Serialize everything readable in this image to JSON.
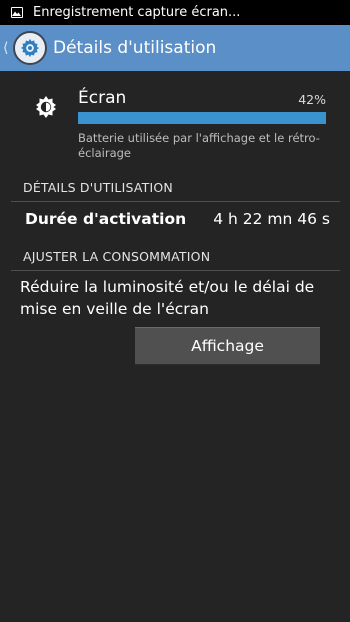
{
  "status_bar": {
    "notification_icon": "image-icon",
    "text": "Enregistrement capture écran..."
  },
  "action_bar": {
    "back_icon": "chevron-left-icon",
    "app_icon": "gear-icon",
    "title": "Détails d'utilisation"
  },
  "battery_item": {
    "icon": "brightness-icon",
    "title": "Écran",
    "percent_label": "42%",
    "usage_fraction": 0.42,
    "description": "Batterie utilisée par l'affichage et le rétro-éclairage",
    "bar_color": "#3a93cf"
  },
  "usage_details": {
    "header": "DÉTAILS D'UTILISATION",
    "rows": [
      {
        "label": "Durée d'activation",
        "value": "4 h 22 mn 46 s"
      }
    ]
  },
  "adjust": {
    "header": "AJUSTER LA CONSOMMATION",
    "text": "Réduire la luminosité et/ou le délai de mise en veille de l'écran",
    "button_label": "Affichage"
  },
  "colors": {
    "accent": "#5b8fc7",
    "background": "#242424"
  }
}
